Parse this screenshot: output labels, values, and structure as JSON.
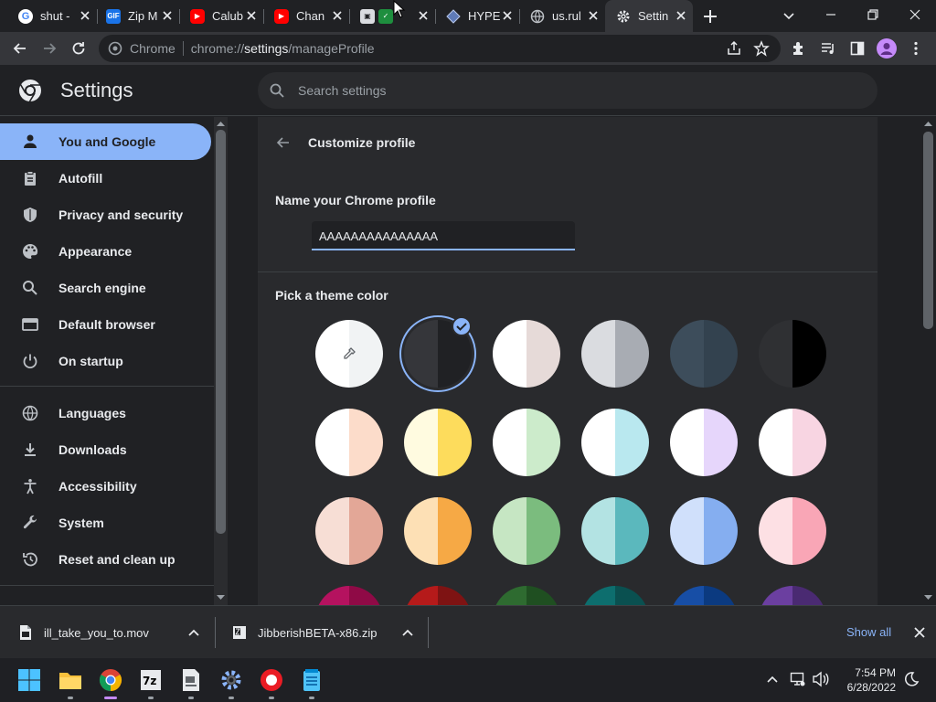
{
  "tabs": [
    {
      "title": "shut -",
      "favicon": "google-icon",
      "color": "#4285f4"
    },
    {
      "title": "Zip M",
      "favicon": "gif-icon",
      "color": "#1a73e8"
    },
    {
      "title": "Calub",
      "favicon": "youtube-icon",
      "color": "#ff0000"
    },
    {
      "title": "Chan",
      "favicon": "youtube-icon",
      "color": "#ff0000"
    },
    {
      "title": "",
      "favicon": "save-icon",
      "color": "#5f6368"
    },
    {
      "title": "HYPE",
      "favicon": "hype-icon",
      "color": "#8ab4f8"
    },
    {
      "title": "us.rul",
      "favicon": "globe-icon",
      "color": "#9aa0a6"
    },
    {
      "title": "Settin",
      "favicon": "gear-icon",
      "color": "#e8eaed"
    }
  ],
  "omnibox": {
    "chip": "Chrome",
    "url_scheme": "chrome://",
    "url_host": "settings",
    "url_path": "/manageProfile"
  },
  "header": {
    "title": "Settings",
    "search_placeholder": "Search settings"
  },
  "sidebar": {
    "items": [
      {
        "label": "You and Google",
        "icon": "person-icon"
      },
      {
        "label": "Autofill",
        "icon": "clipboard-icon"
      },
      {
        "label": "Privacy and security",
        "icon": "shield-icon"
      },
      {
        "label": "Appearance",
        "icon": "palette-icon"
      },
      {
        "label": "Search engine",
        "icon": "search-icon"
      },
      {
        "label": "Default browser",
        "icon": "browser-icon"
      },
      {
        "label": "On startup",
        "icon": "power-icon"
      },
      {
        "label": "Languages",
        "icon": "globe-icon"
      },
      {
        "label": "Downloads",
        "icon": "download-icon"
      },
      {
        "label": "Accessibility",
        "icon": "accessibility-icon"
      },
      {
        "label": "System",
        "icon": "wrench-icon"
      },
      {
        "label": "Reset and clean up",
        "icon": "history-icon"
      }
    ]
  },
  "main": {
    "page_title": "Customize profile",
    "name_label": "Name your Chrome profile",
    "name_value": "AAAAAAAAAAAAAAA",
    "theme_label": "Pick a theme color",
    "swatches": [
      {
        "left": "#ffffff",
        "right": "#f1f3f4",
        "kind": "custom"
      },
      {
        "left": "#35363a",
        "right": "#202124",
        "kind": "selected"
      },
      {
        "left": "#ffffff",
        "right": "#e6dad8"
      },
      {
        "left": "#dadce0",
        "right": "#a8acb3"
      },
      {
        "left": "#3d4d5b",
        "right": "#33424f"
      },
      {
        "left": "#2f3033",
        "right": "#000000"
      },
      {
        "left": "#ffffff",
        "right": "#fcdcca"
      },
      {
        "left": "#fffbe0",
        "right": "#fddc5c"
      },
      {
        "left": "#ffffff",
        "right": "#ccebcb"
      },
      {
        "left": "#ffffff",
        "right": "#b9e8ef"
      },
      {
        "left": "#ffffff",
        "right": "#e6d6fb"
      },
      {
        "left": "#ffffff",
        "right": "#f8d5e2"
      },
      {
        "left": "#f7ded5",
        "right": "#e3a797"
      },
      {
        "left": "#fde0b5",
        "right": "#f6a945"
      },
      {
        "left": "#c6e6c3",
        "right": "#7bbc7e"
      },
      {
        "left": "#b3e3e3",
        "right": "#5bb8bd"
      },
      {
        "left": "#d0e0fb",
        "right": "#85aef0"
      },
      {
        "left": "#fde0e4",
        "right": "#f9a6b6"
      },
      {
        "left": "#b5125f",
        "right": "#8f0a46"
      },
      {
        "left": "#b51a1a",
        "right": "#7e1313"
      },
      {
        "left": "#2e6b30",
        "right": "#1f4f21"
      },
      {
        "left": "#0d6e6e",
        "right": "#0a5050"
      },
      {
        "left": "#174ea6",
        "right": "#0b3a80"
      },
      {
        "left": "#6b3fa0",
        "right": "#4a2a72"
      }
    ]
  },
  "downloads": {
    "items": [
      {
        "name": "ill_take_you_to.mov"
      },
      {
        "name": "JibberishBETA-x86.zip"
      }
    ],
    "show_all": "Show all"
  },
  "taskbar": {
    "time": "7:54 PM",
    "date": "6/28/2022"
  }
}
